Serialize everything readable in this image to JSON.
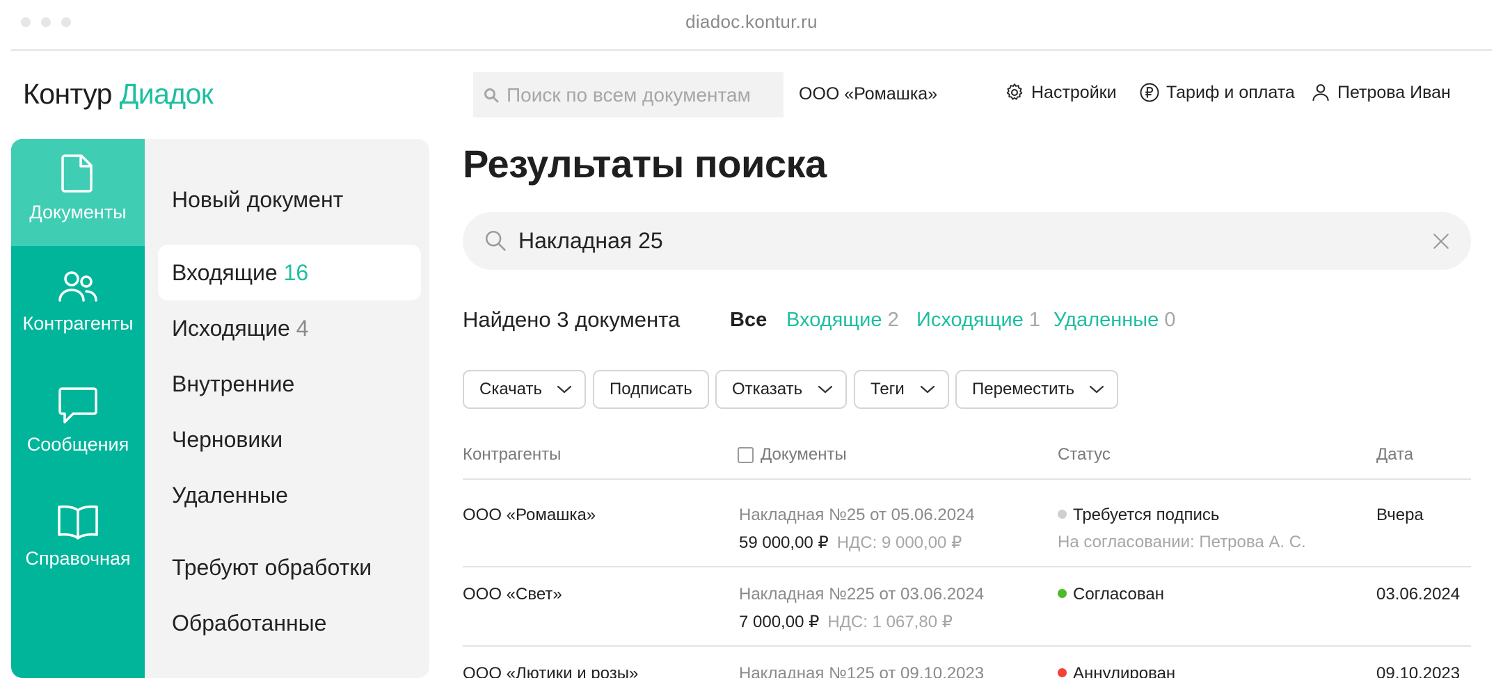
{
  "browser": {
    "url": "diadoc.kontur.ru"
  },
  "header": {
    "logo_part1": "Контур",
    "logo_part2": "Диадок",
    "search_placeholder": "Поиск по всем документам",
    "org": "ООО «Ромашка»",
    "settings": "Настройки",
    "billing": "Тариф и оплата",
    "user": "Петрова Иван"
  },
  "rail": [
    {
      "label": "Документы",
      "icon": "document-icon",
      "active": true
    },
    {
      "label": "Контрагенты",
      "icon": "users-icon"
    },
    {
      "label": "Сообщения",
      "icon": "chat-icon"
    },
    {
      "label": "Справочная",
      "icon": "book-icon"
    }
  ],
  "submenu": {
    "new_doc": "Новый документ",
    "incoming": {
      "label": "Входящие",
      "count": "16"
    },
    "outgoing": {
      "label": "Исходящие",
      "count": "4"
    },
    "internal": "Внутренние",
    "drafts": "Черновики",
    "deleted": "Удаленные",
    "need_processing": "Требуют обработки",
    "processed": "Обработанные"
  },
  "main": {
    "title": "Результаты поиска",
    "search_value": "Накладная 25",
    "found": "Найдено 3 документа",
    "filters": {
      "all": "Все",
      "incoming": {
        "label": "Входящие",
        "count": "2"
      },
      "outgoing": {
        "label": "Исходящие",
        "count": "1"
      },
      "deleted": {
        "label": "Удаленные",
        "count": "0"
      }
    },
    "actions": {
      "download": "Скачать",
      "sign": "Подписать",
      "reject": "Отказать",
      "tags": "Теги",
      "move": "Переместить"
    },
    "columns": {
      "counterparty": "Контрагенты",
      "documents": "Документы",
      "status": "Статус",
      "date": "Дата"
    },
    "rows": [
      {
        "counterparty": "ООО «Ромашка»",
        "doc": "Накладная №25 от 05.06.2024",
        "amount": "59 000,00 ₽",
        "vat": "НДС: 9 000,00 ₽",
        "status": "Требуется подпись",
        "status_color": "#cfcfcf",
        "status_note": "На согласовании: Петрова А. С.",
        "date": "Вчера"
      },
      {
        "counterparty": "ООО «Свет»",
        "doc": "Накладная №225 от 03.06.2024",
        "amount": "7 000,00 ₽",
        "vat": "НДС: 1 067,80 ₽",
        "status": "Согласован",
        "status_color": "#4fba2c",
        "date": "03.06.2024"
      },
      {
        "counterparty": "ООО «Лютики и розы»",
        "doc": "Накладная №125 от 09.10.2023",
        "status": "Аннулирован",
        "status_color": "#f2433a",
        "date": "09.10.2023"
      }
    ]
  },
  "colors": {
    "brand_green": "#00b59a",
    "accent_text": "#1dbf9f"
  }
}
